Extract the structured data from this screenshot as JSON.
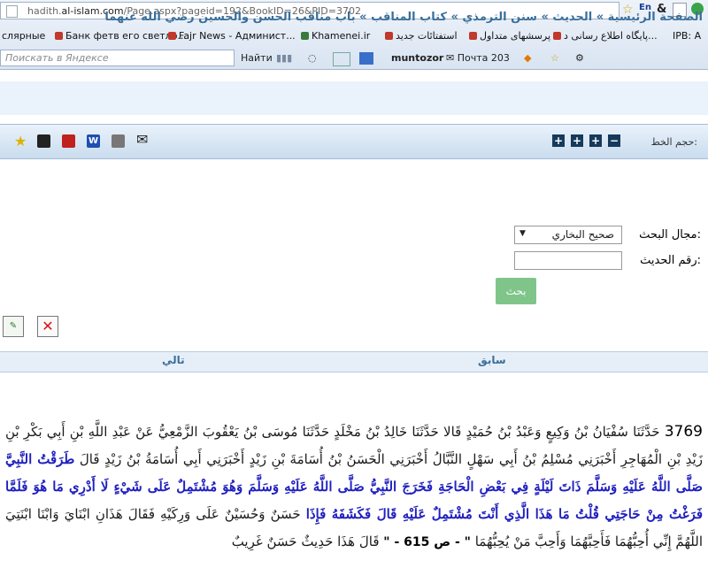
{
  "browser": {
    "url_prefix": "hadith.",
    "url_domain": "al-islam.com",
    "url_path": "/Page.aspx?pageid=192&BookID=26&PID=3702",
    "lang_badge": "En",
    "bookmarks": [
      {
        "label": "слярные"
      },
      {
        "label": "Банк фетв его светло..."
      },
      {
        "label": "Fajr News - Админист..."
      },
      {
        "label": "Khamenei.ir"
      },
      {
        "label": "استفتائات جدید"
      },
      {
        "label": "پرسشهای متداول"
      },
      {
        "label": "پایگاه اطلاع رسانی د..."
      },
      {
        "label": "IPB: A"
      }
    ],
    "search_placeholder": "Поискать в Яндексе",
    "find_label": "Найти",
    "toolbar_user": "muntozor",
    "mail_label": "Почта 203"
  },
  "page": {
    "breadcrumb": "الصفحة الرئيسية » الحديث » سنن الترمذي » كتاب المناقب » باب مناقب الحسن والحسين رضي الله عنهما",
    "font_size_label": "حجم الخط:",
    "font_buttons": [
      "+",
      "+",
      "+",
      "+",
      "−"
    ],
    "search_scope_label": "مجال البحث:",
    "search_scope_value": "صحيح البخاري",
    "hadith_number_label": "رقم الحديث:",
    "hadith_number_value": "",
    "search_button": "بحث",
    "prev_label": "سابق",
    "next_label": "تالي"
  },
  "hadith": {
    "number": "3769",
    "part1": "حَدَّثَنَا سُفْيَانُ بْنُ وَكِيعٍ وَعَبْدُ بْنُ حُمَيْدٍ قَالا حَدَّثَنَا خَالِدُ بْنُ مَخْلَدٍ حَدَّثَنَا مُوسَى بْنُ يَعْقُوبَ الزَّمْعِيُّ عَنْ عَبْدِ اللَّهِ بْنِ أَبِي بَكْرِ بْنِ زَيْدِ بْنِ الْمُهَاجِرِ أَخْبَرَنِي مُسْلِمُ بْنُ أَبِي سَهْلٍ النَّبَّالُ أَخْبَرَنِي الْحَسَنُ بْنُ أُسَامَةَ بْنِ زَيْدٍ أَخْبَرَنِي أَبِي أُسَامَةُ بْنُ زَيْدٍ قَالَ",
    "matn": "طَرَقْتُ النَّبِيَّ صَلَّى اللَّهُ عَلَيْهِ وَسَلَّمَ ذَاتَ لَيْلَةٍ فِي بَعْضِ الْحَاجَةِ فَخَرَجَ النَّبِيُّ صَلَّى اللَّهُ عَلَيْهِ وَسَلَّمَ وَهُوَ مُشْتَمِلٌ عَلَى شَيْءٍ لَا أَدْرِي مَا هُوَ فَلَمَّا فَرَغْتُ مِنْ حَاجَتِي قُلْتُ مَا هَذَا الَّذِي أَنْتَ مُشْتَمِلٌ عَلَيْهِ قَالَ فَكَشَفَهُ فَإِذَا",
    "part2": "حَسَنٌ وَحُسَيْنٌ عَلَى وَرِكَيْهِ فَقَالَ هَذَانِ ابْنَايَ وَابْنَا ابْنَتِيَ اللَّهُمَّ إِنِّي أُحِبُّهُمَا فَأَحِبَّهُمَا وَأَحِبَّ مَنْ يُحِبُّهُمَا",
    "page_ref": "\" - ص 615 - \"",
    "tail": "قَالَ هَذَا حَدِيثٌ حَسَنٌ غَرِيبٌ"
  },
  "colors": {
    "breadcrumb": "#3a6f9a",
    "search_button": "#7fc58a",
    "matn": "#2020c0"
  }
}
